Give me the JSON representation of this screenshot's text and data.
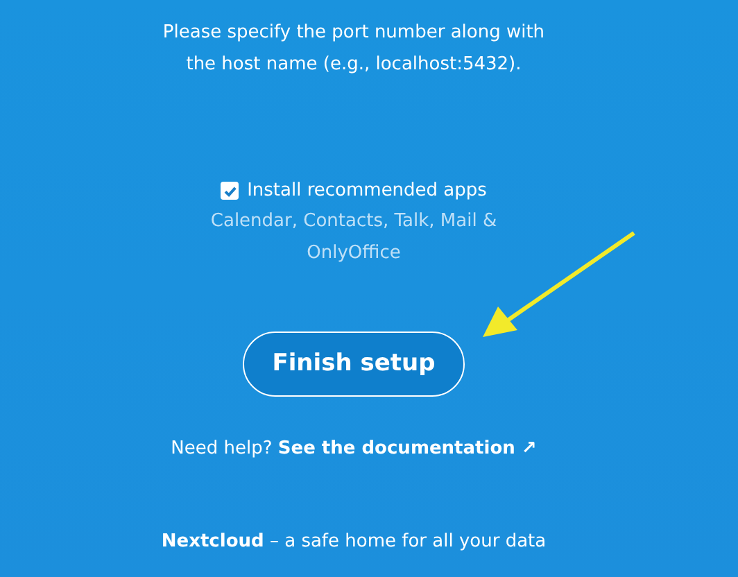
{
  "hint": "Please specify the port number along with the host name (e.g., localhost:5432).",
  "install_apps": {
    "label": "Install recommended apps",
    "checked": true,
    "apps": "Calendar, Contacts, Talk, Mail & OnlyOffice"
  },
  "finish_button": "Finish setup",
  "help": {
    "text": "Need help?",
    "link": "See the documentation ↗"
  },
  "footer": "**Nextcloud** – a safe home for all your data"
}
